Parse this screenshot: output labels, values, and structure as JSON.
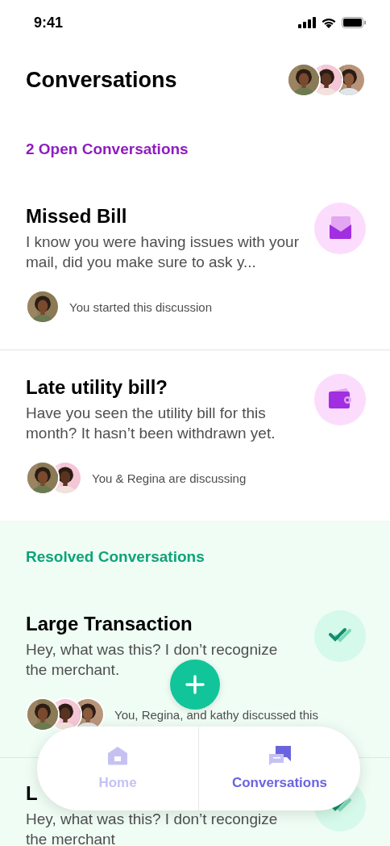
{
  "status_bar": {
    "time": "9:41"
  },
  "header": {
    "title": "Conversations"
  },
  "sections": [
    {
      "kind": "open",
      "title": "2 Open Conversations",
      "conversations": [
        {
          "kind": "mail",
          "title": "Missed Bill",
          "body": "I know you were having issues with your mail, did you make sure to ask y...",
          "people": "You started this discussion"
        },
        {
          "kind": "wallet",
          "title": "Late utility bill?",
          "body": "Have you seen the utility bill for this month? It hasn’t been withdrawn yet.",
          "people": "You & Regina are discussing"
        }
      ]
    },
    {
      "kind": "resolved",
      "title": "Resolved Conversations",
      "conversations": [
        {
          "kind": "check",
          "title": "Large Transaction",
          "body": "Hey, what was this? I don’t recognize the merchant.",
          "people": "You, Regina, and kathy discussed this"
        },
        {
          "kind": "check",
          "title": "L",
          "body": "Hey, what was this? I don’t recongize the merchant"
        }
      ]
    }
  ],
  "tabs": [
    {
      "kind": "home",
      "label": "Home",
      "selected": false
    },
    {
      "kind": "chat",
      "label": "Conversations",
      "selected": true
    }
  ]
}
